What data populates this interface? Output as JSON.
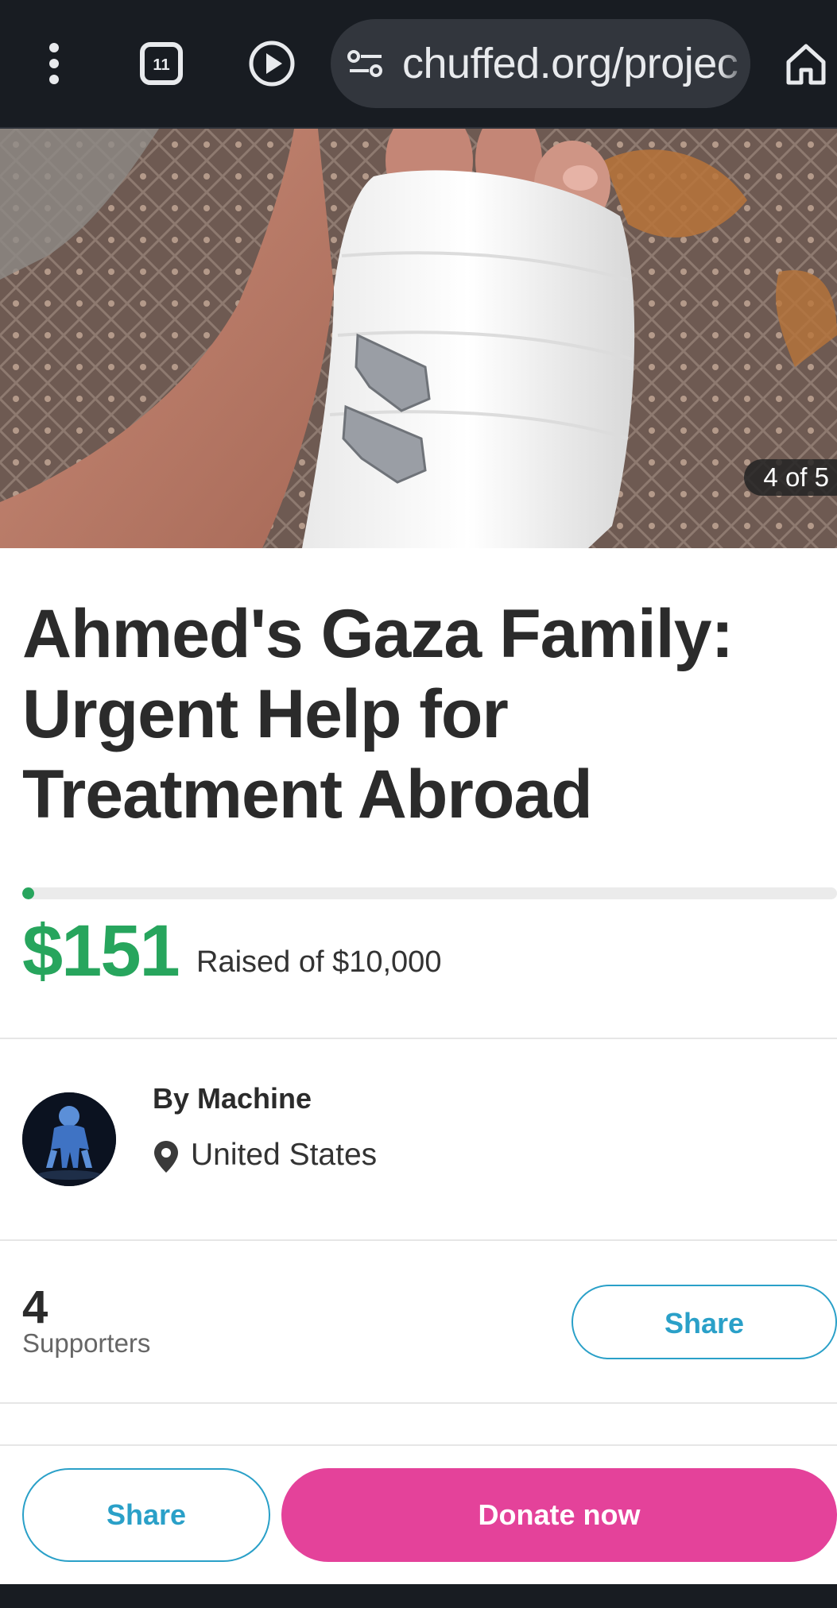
{
  "browser": {
    "url": "chuffed.org/projec",
    "icons": [
      "more-vert-icon",
      "tab-switcher-icon",
      "play-icon",
      "site-settings-icon",
      "home-icon"
    ]
  },
  "hero": {
    "slide_counter": "4 of 5"
  },
  "campaign": {
    "title": "Ahmed's Gaza Family: Urgent Help for Treatment Abroad",
    "amount_raised": "$151",
    "raised_label": "Raised of $10,000",
    "progress_fraction": 0.0151
  },
  "organizer": {
    "by_line": "By Machine",
    "location": "United States"
  },
  "supporters": {
    "count": "4",
    "label": "Supporters",
    "share_label": "Share"
  },
  "actions": {
    "share_label": "Share",
    "donate_label": "Donate now"
  },
  "colors": {
    "accent_green": "#27a55d",
    "donate_pink": "#e4429a",
    "share_blue": "#2aa0c8",
    "browser_bar": "#181c22"
  }
}
